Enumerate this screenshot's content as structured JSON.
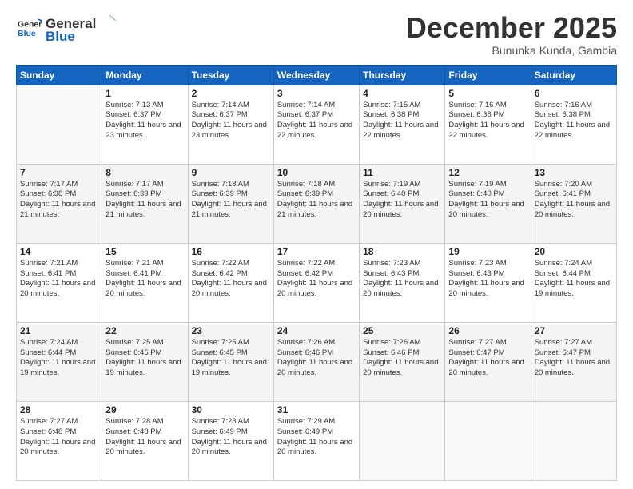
{
  "logo": {
    "line1": "General",
    "line2": "Blue"
  },
  "title": "December 2025",
  "subtitle": "Bununka Kunda, Gambia",
  "days_of_week": [
    "Sunday",
    "Monday",
    "Tuesday",
    "Wednesday",
    "Thursday",
    "Friday",
    "Saturday"
  ],
  "weeks": [
    [
      {
        "day": "",
        "sunrise": "",
        "sunset": "",
        "daylight": ""
      },
      {
        "day": "1",
        "sunrise": "Sunrise: 7:13 AM",
        "sunset": "Sunset: 6:37 PM",
        "daylight": "Daylight: 11 hours and 23 minutes."
      },
      {
        "day": "2",
        "sunrise": "Sunrise: 7:14 AM",
        "sunset": "Sunset: 6:37 PM",
        "daylight": "Daylight: 11 hours and 23 minutes."
      },
      {
        "day": "3",
        "sunrise": "Sunrise: 7:14 AM",
        "sunset": "Sunset: 6:37 PM",
        "daylight": "Daylight: 11 hours and 22 minutes."
      },
      {
        "day": "4",
        "sunrise": "Sunrise: 7:15 AM",
        "sunset": "Sunset: 6:38 PM",
        "daylight": "Daylight: 11 hours and 22 minutes."
      },
      {
        "day": "5",
        "sunrise": "Sunrise: 7:16 AM",
        "sunset": "Sunset: 6:38 PM",
        "daylight": "Daylight: 11 hours and 22 minutes."
      },
      {
        "day": "6",
        "sunrise": "Sunrise: 7:16 AM",
        "sunset": "Sunset: 6:38 PM",
        "daylight": "Daylight: 11 hours and 22 minutes."
      }
    ],
    [
      {
        "day": "7",
        "sunrise": "Sunrise: 7:17 AM",
        "sunset": "Sunset: 6:38 PM",
        "daylight": "Daylight: 11 hours and 21 minutes."
      },
      {
        "day": "8",
        "sunrise": "Sunrise: 7:17 AM",
        "sunset": "Sunset: 6:39 PM",
        "daylight": "Daylight: 11 hours and 21 minutes."
      },
      {
        "day": "9",
        "sunrise": "Sunrise: 7:18 AM",
        "sunset": "Sunset: 6:39 PM",
        "daylight": "Daylight: 11 hours and 21 minutes."
      },
      {
        "day": "10",
        "sunrise": "Sunrise: 7:18 AM",
        "sunset": "Sunset: 6:39 PM",
        "daylight": "Daylight: 11 hours and 21 minutes."
      },
      {
        "day": "11",
        "sunrise": "Sunrise: 7:19 AM",
        "sunset": "Sunset: 6:40 PM",
        "daylight": "Daylight: 11 hours and 20 minutes."
      },
      {
        "day": "12",
        "sunrise": "Sunrise: 7:19 AM",
        "sunset": "Sunset: 6:40 PM",
        "daylight": "Daylight: 11 hours and 20 minutes."
      },
      {
        "day": "13",
        "sunrise": "Sunrise: 7:20 AM",
        "sunset": "Sunset: 6:41 PM",
        "daylight": "Daylight: 11 hours and 20 minutes."
      }
    ],
    [
      {
        "day": "14",
        "sunrise": "Sunrise: 7:21 AM",
        "sunset": "Sunset: 6:41 PM",
        "daylight": "Daylight: 11 hours and 20 minutes."
      },
      {
        "day": "15",
        "sunrise": "Sunrise: 7:21 AM",
        "sunset": "Sunset: 6:41 PM",
        "daylight": "Daylight: 11 hours and 20 minutes."
      },
      {
        "day": "16",
        "sunrise": "Sunrise: 7:22 AM",
        "sunset": "Sunset: 6:42 PM",
        "daylight": "Daylight: 11 hours and 20 minutes."
      },
      {
        "day": "17",
        "sunrise": "Sunrise: 7:22 AM",
        "sunset": "Sunset: 6:42 PM",
        "daylight": "Daylight: 11 hours and 20 minutes."
      },
      {
        "day": "18",
        "sunrise": "Sunrise: 7:23 AM",
        "sunset": "Sunset: 6:43 PM",
        "daylight": "Daylight: 11 hours and 20 minutes."
      },
      {
        "day": "19",
        "sunrise": "Sunrise: 7:23 AM",
        "sunset": "Sunset: 6:43 PM",
        "daylight": "Daylight: 11 hours and 20 minutes."
      },
      {
        "day": "20",
        "sunrise": "Sunrise: 7:24 AM",
        "sunset": "Sunset: 6:44 PM",
        "daylight": "Daylight: 11 hours and 19 minutes."
      }
    ],
    [
      {
        "day": "21",
        "sunrise": "Sunrise: 7:24 AM",
        "sunset": "Sunset: 6:44 PM",
        "daylight": "Daylight: 11 hours and 19 minutes."
      },
      {
        "day": "22",
        "sunrise": "Sunrise: 7:25 AM",
        "sunset": "Sunset: 6:45 PM",
        "daylight": "Daylight: 11 hours and 19 minutes."
      },
      {
        "day": "23",
        "sunrise": "Sunrise: 7:25 AM",
        "sunset": "Sunset: 6:45 PM",
        "daylight": "Daylight: 11 hours and 19 minutes."
      },
      {
        "day": "24",
        "sunrise": "Sunrise: 7:26 AM",
        "sunset": "Sunset: 6:46 PM",
        "daylight": "Daylight: 11 hours and 20 minutes."
      },
      {
        "day": "25",
        "sunrise": "Sunrise: 7:26 AM",
        "sunset": "Sunset: 6:46 PM",
        "daylight": "Daylight: 11 hours and 20 minutes."
      },
      {
        "day": "26",
        "sunrise": "Sunrise: 7:27 AM",
        "sunset": "Sunset: 6:47 PM",
        "daylight": "Daylight: 11 hours and 20 minutes."
      },
      {
        "day": "27",
        "sunrise": "Sunrise: 7:27 AM",
        "sunset": "Sunset: 6:47 PM",
        "daylight": "Daylight: 11 hours and 20 minutes."
      }
    ],
    [
      {
        "day": "28",
        "sunrise": "Sunrise: 7:27 AM",
        "sunset": "Sunset: 6:48 PM",
        "daylight": "Daylight: 11 hours and 20 minutes."
      },
      {
        "day": "29",
        "sunrise": "Sunrise: 7:28 AM",
        "sunset": "Sunset: 6:48 PM",
        "daylight": "Daylight: 11 hours and 20 minutes."
      },
      {
        "day": "30",
        "sunrise": "Sunrise: 7:28 AM",
        "sunset": "Sunset: 6:49 PM",
        "daylight": "Daylight: 11 hours and 20 minutes."
      },
      {
        "day": "31",
        "sunrise": "Sunrise: 7:29 AM",
        "sunset": "Sunset: 6:49 PM",
        "daylight": "Daylight: 11 hours and 20 minutes."
      },
      {
        "day": "",
        "sunrise": "",
        "sunset": "",
        "daylight": ""
      },
      {
        "day": "",
        "sunrise": "",
        "sunset": "",
        "daylight": ""
      },
      {
        "day": "",
        "sunrise": "",
        "sunset": "",
        "daylight": ""
      }
    ]
  ]
}
